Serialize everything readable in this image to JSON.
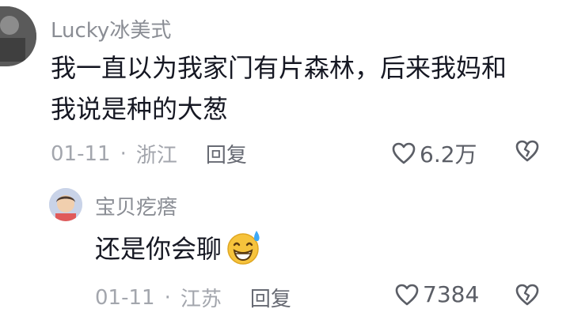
{
  "comment": {
    "username": "Lucky冰美式",
    "text_line1": "我一直以为我家门有片森林，后来我妈和",
    "text_line2": "我说是种的大葱",
    "date": "01-11",
    "separator": "·",
    "location": "浙江",
    "reply_label": "回复",
    "like_count": "6.2万",
    "icons": {
      "like": "heart-outline-icon",
      "dislike": "broken-heart-icon"
    }
  },
  "reply": {
    "username": "宝贝疙瘩",
    "text": "还是你会聊",
    "emoji": "grinning-sweat-emoji",
    "date": "01-11",
    "separator": "·",
    "location": "江苏",
    "reply_label": "回复",
    "like_count": "7384",
    "icons": {
      "like": "heart-outline-icon",
      "dislike": "broken-heart-icon"
    }
  },
  "colors": {
    "username": "#8a8d94",
    "content": "#161823",
    "meta": "#a3a6ad",
    "emoji_face": "#f6c33c",
    "sweat_drop": "#3fa9f5"
  }
}
